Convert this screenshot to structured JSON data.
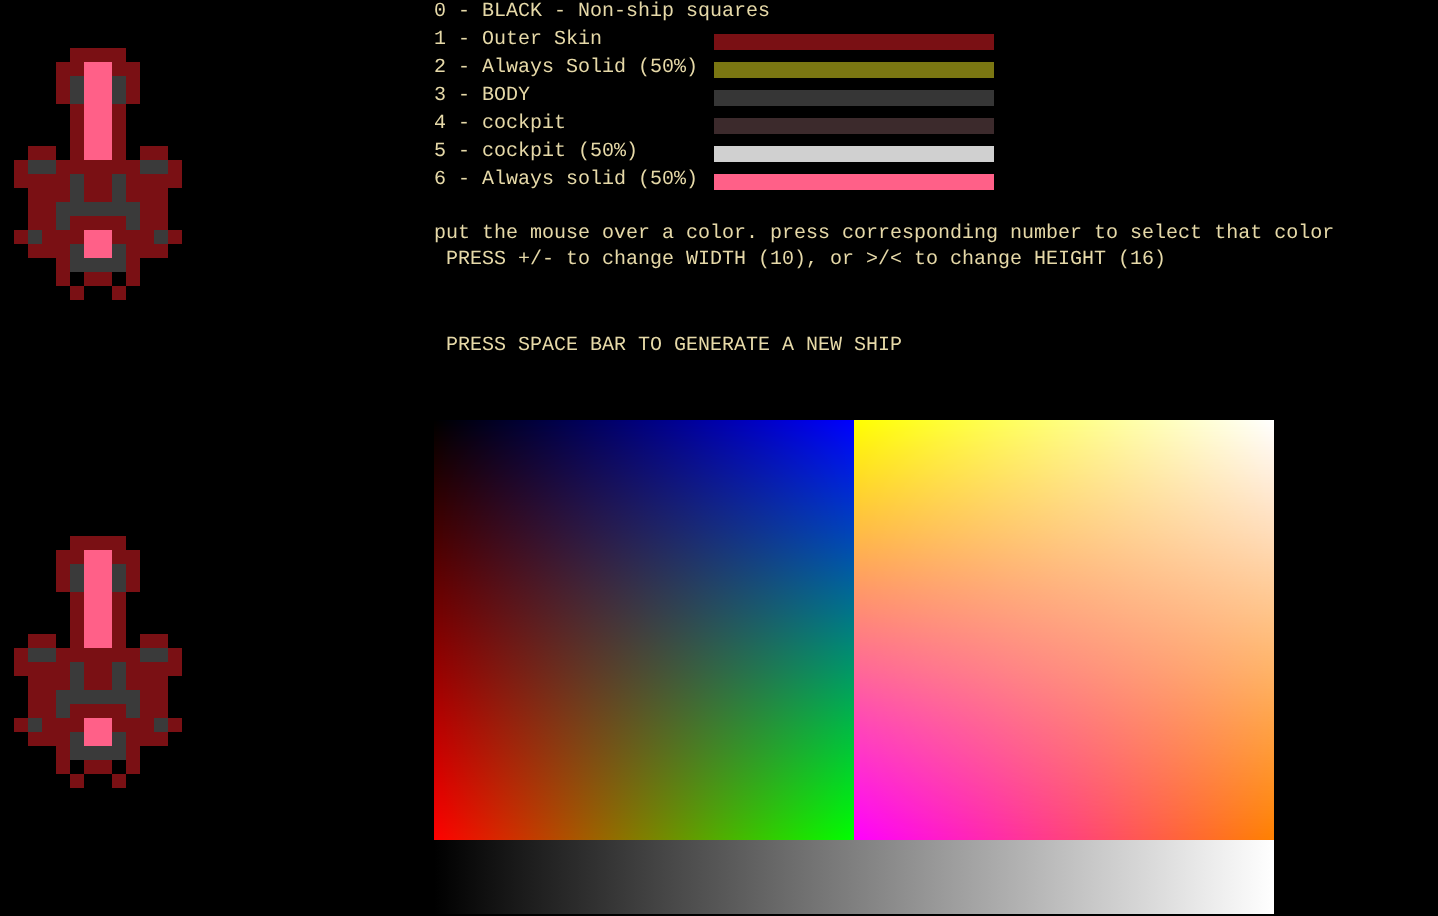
{
  "legend": [
    {
      "label": "0 - BLACK - Non-ship squares"
    },
    {
      "label": "1 - Outer Skin",
      "color": "#7a1014"
    },
    {
      "label": "2 - Always Solid (50%)",
      "color": "#7a7612"
    },
    {
      "label": "3 - BODY",
      "color": "#363636"
    },
    {
      "label": "4 - cockpit",
      "color": "#3c2a2c"
    },
    {
      "label": "5 - cockpit (50%)",
      "color": "#d0d0d0"
    },
    {
      "label": "6 - Always solid (50%)",
      "color": "#ff6088"
    }
  ],
  "instructions": [
    "put the mouse over a color. press corresponding number to select that color",
    " PRESS +/- to change WIDTH (10), or >/< to change HEIGHT (16)"
  ],
  "prompt": " PRESS SPACE BAR TO GENERATE A NEW SHIP"
}
